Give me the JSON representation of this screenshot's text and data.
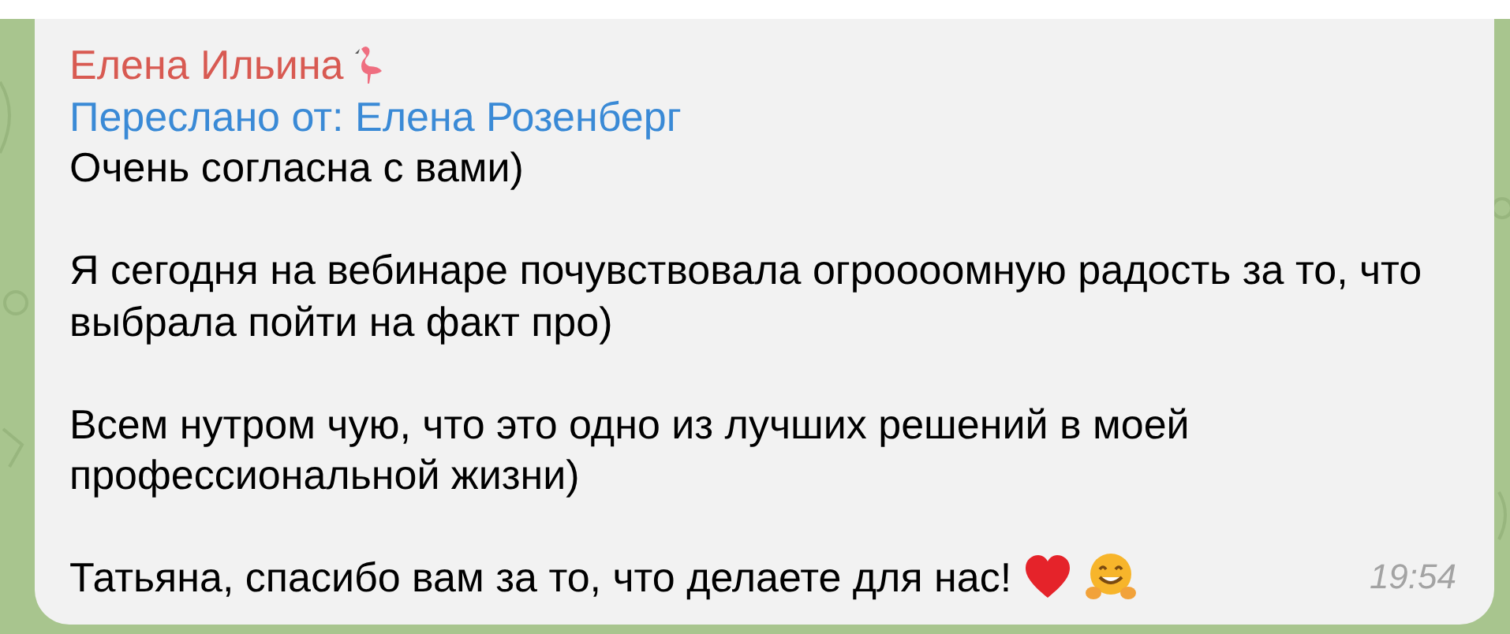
{
  "message": {
    "sender": "Елена Ильина",
    "forwarded_from": "Переслано от: Елена Розенберг",
    "paragraphs": [
      "Очень согласна с вами)",
      "Я сегодня на вебинаре почувствовала огроооомную радость за то, что выбрала пойти на факт про)",
      "Всем нутром чую, что это одно из лучших решений в моей профессиональной жизни)",
      "Татьяна, спасибо вам за то, что делаете для нас!"
    ],
    "time": "19:54"
  }
}
